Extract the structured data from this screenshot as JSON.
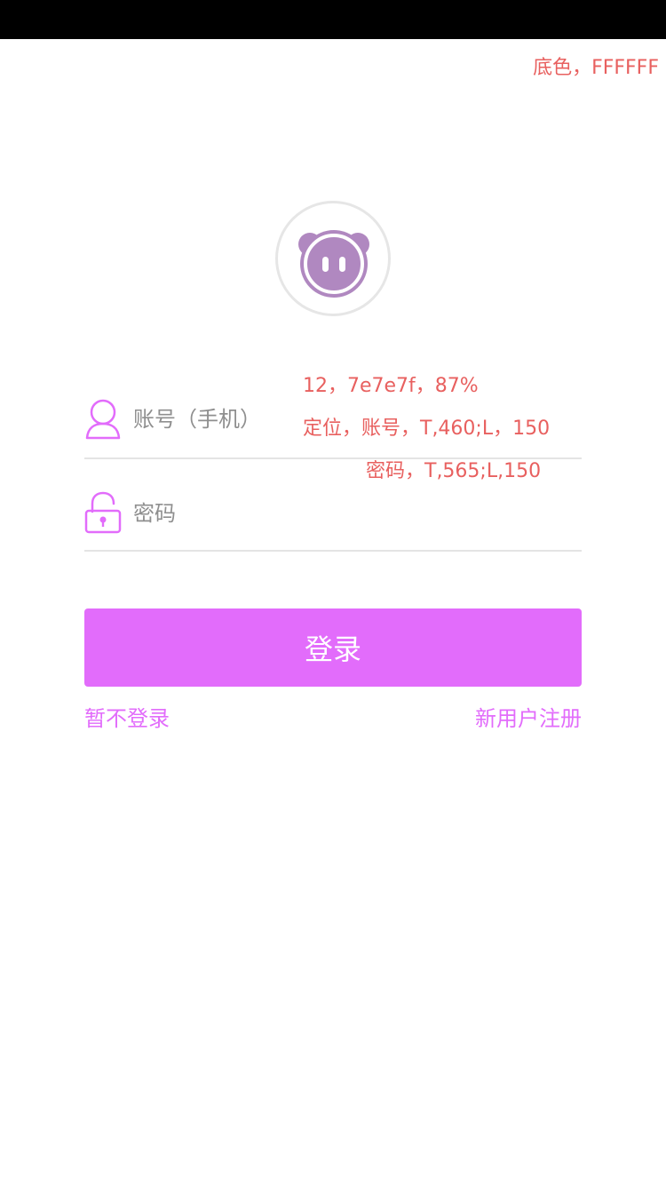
{
  "annotations": {
    "background_note": "底色，FFFFFF",
    "font_note": "12，7e7e7f，87%",
    "account_position_note": "定位，账号，T,460;L，150",
    "password_position_note": "密码，T,565;L,150"
  },
  "logo": {
    "icon": "pig-face-icon",
    "color": "#b088c0",
    "ring_color": "#e6e6e6"
  },
  "form": {
    "account": {
      "placeholder": "账号（手机）",
      "value": "",
      "icon": "user-icon"
    },
    "password": {
      "placeholder": "密码",
      "value": "",
      "icon": "lock-icon"
    }
  },
  "actions": {
    "login_label": "登录",
    "skip_label": "暂不登录",
    "register_label": "新用户注册"
  },
  "colors": {
    "accent": "#e26cfb",
    "background": "#ffffff",
    "annotation": "#e8605f",
    "input_text": "#7e7e7f"
  }
}
